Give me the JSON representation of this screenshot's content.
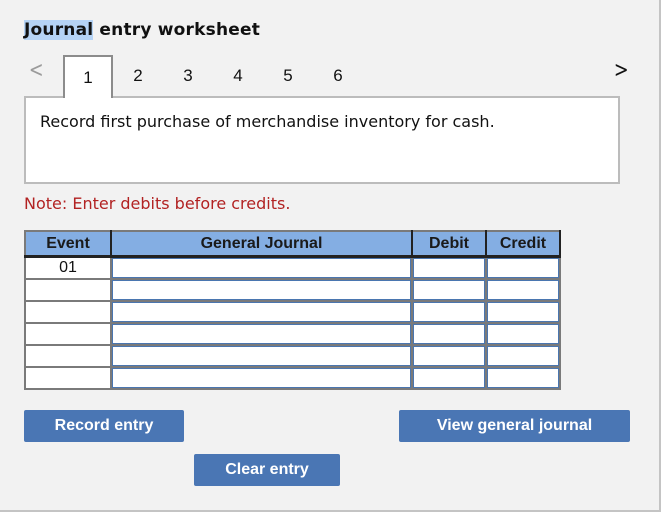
{
  "header": {
    "title_highlighted": "Journal",
    "title_rest": " entry worksheet"
  },
  "navigation": {
    "prev_icon": "chevron-left-icon",
    "next_icon": "chevron-right-icon",
    "prev_glyph": "<",
    "next_glyph": ">",
    "tabs": [
      {
        "label": "1",
        "active": true
      },
      {
        "label": "2",
        "active": false
      },
      {
        "label": "3",
        "active": false
      },
      {
        "label": "4",
        "active": false
      },
      {
        "label": "5",
        "active": false
      },
      {
        "label": "6",
        "active": false
      }
    ]
  },
  "task": {
    "description": "Record first purchase of merchandise inventory for cash."
  },
  "note": "Note: Enter debits before credits.",
  "journal": {
    "columns": [
      "Event",
      "General Journal",
      "Debit",
      "Credit"
    ],
    "rows": [
      {
        "event": "01",
        "general_journal": "",
        "debit": "",
        "credit": ""
      },
      {
        "event": "",
        "general_journal": "",
        "debit": "",
        "credit": ""
      },
      {
        "event": "",
        "general_journal": "",
        "debit": "",
        "credit": ""
      },
      {
        "event": "",
        "general_journal": "",
        "debit": "",
        "credit": ""
      },
      {
        "event": "",
        "general_journal": "",
        "debit": "",
        "credit": ""
      },
      {
        "event": "",
        "general_journal": "",
        "debit": "",
        "credit": ""
      }
    ]
  },
  "buttons": {
    "record_entry": "Record entry",
    "view_general_journal": "View general journal",
    "clear_entry": "Clear entry"
  },
  "colors": {
    "header_bg": "#84aee3",
    "button_bg": "#4a76b4",
    "note_color": "#b22222",
    "title_highlight": "#b5d3f5"
  }
}
